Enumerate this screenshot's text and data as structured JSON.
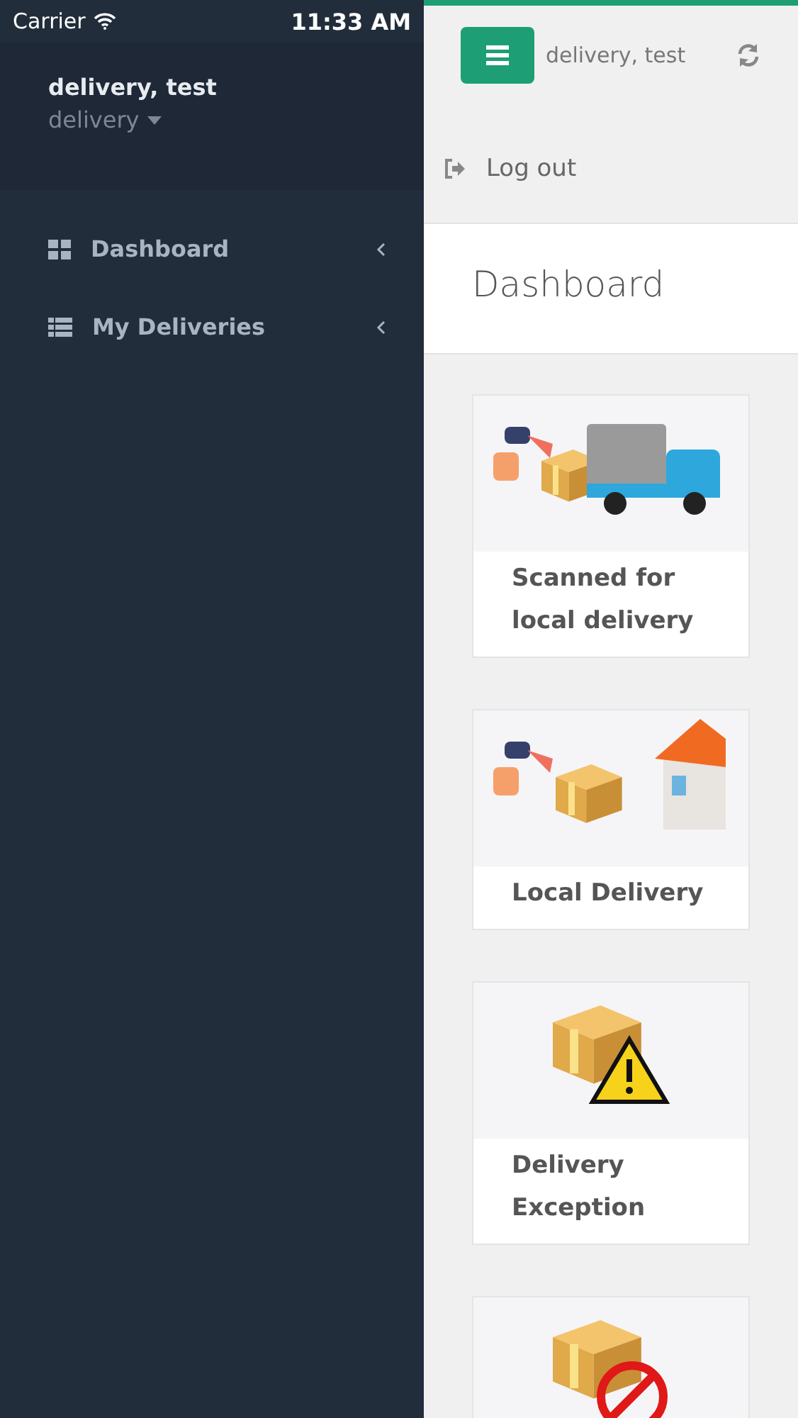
{
  "status_bar": {
    "carrier": "Carrier",
    "time": "11:33 AM"
  },
  "sidebar": {
    "user_name": "delivery, test",
    "role": "delivery",
    "items": [
      {
        "label": "Dashboard",
        "kind": "grid",
        "expanded": false
      },
      {
        "label": "My Deliveries",
        "kind": "list",
        "expanded": false
      }
    ]
  },
  "header": {
    "user_name": "delivery, test",
    "logout": "Log out"
  },
  "page_title": "Dashboard",
  "cards": [
    {
      "kind": "scan-truck",
      "title": "Scanned for local delivery"
    },
    {
      "kind": "scan-house",
      "title": "Local Delivery"
    },
    {
      "kind": "warning",
      "title": "Delivery Exception"
    },
    {
      "kind": "blocked"
    }
  ]
}
